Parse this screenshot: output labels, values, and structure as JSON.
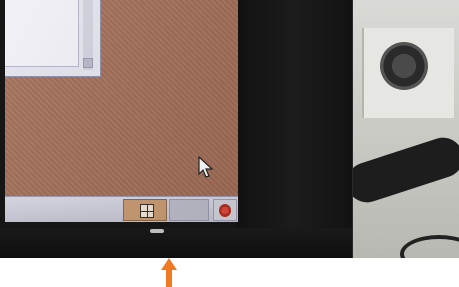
{
  "scene": {
    "annotation": {
      "icon": "arrow-up-icon",
      "color": "#f07a22"
    }
  },
  "screen": {
    "wallpaper_color": "#a8765f",
    "taskbar": {
      "items": [
        {
          "icon": "start-grid-icon"
        },
        {
          "icon": "taskbar-blank-slot"
        },
        {
          "icon": "trash-icon"
        }
      ]
    },
    "cursor": {
      "icon": "mouse-pointer-icon"
    }
  }
}
